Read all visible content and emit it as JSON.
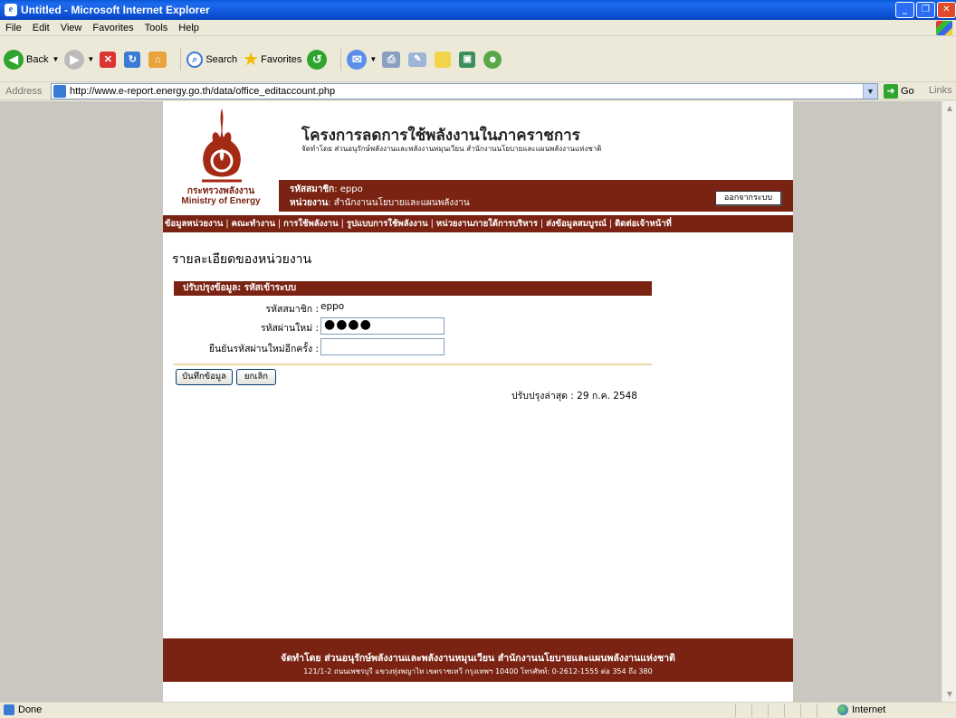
{
  "window": {
    "title": "Untitled - Microsoft Internet Explorer"
  },
  "menu": [
    "File",
    "Edit",
    "View",
    "Favorites",
    "Tools",
    "Help"
  ],
  "toolbar": {
    "back": "Back",
    "search": "Search",
    "favorites": "Favorites"
  },
  "address": {
    "label": "Address",
    "url": "http://www.e-report.energy.go.th/data/office_editaccount.php",
    "go": "Go",
    "links": "Links"
  },
  "header": {
    "ministry_th": "กระทรวงพลังงาน",
    "ministry_en": "Ministry of Energy",
    "project_title": "โครงการลดการใช้พลังงานในภาคราชการ",
    "project_subtitle": "จัดทำโดย ส่วนอนุรักษ์พลังงานและพลังงานหมุนเวียน สำนักงานนโยบายและแผนพลังงานแห่งชาติ"
  },
  "userbar": {
    "code_label": "รหัสสมาชิก",
    "code_value": ": eppo",
    "unit_label": "หน่วยงาน",
    "unit_value": ": สำนักงานนโยบายและแผนพลังงาน",
    "logout": "ออกจากระบบ"
  },
  "nav": [
    "ข้อมูลหน่วยงาน",
    "คณะทำงาน",
    "การใช้พลังงาน",
    "รูปแบบการใช้พลังงาน",
    "หน่วยงานภายใต้การบริหาร",
    "ส่งข้อมูลสมบูรณ์",
    "ติดต่อเจ้าหน้าที่"
  ],
  "page_title": "รายละเอียดของหน่วยงาน",
  "form": {
    "header": "ปรับปรุงข้อมูล: รหัสเข้าระบบ",
    "member_label": "รหัสสมาชิก :",
    "member_value": "eppo",
    "new_password_label": "รหัสผ่านใหม่ :",
    "new_password_value": "●●●●",
    "confirm_password_label": "ยืนยันรหัสผ่านใหม่อีกครั้ง :",
    "confirm_password_value": "",
    "save_button": "บันทึกข้อมูล",
    "cancel_button": "ยกเลิก",
    "last_updated": "ปรับปรุงล่าสุด : 29 ก.ค. 2548"
  },
  "footer": {
    "line1": "จัดทำโดย ส่วนอนุรักษ์พลังงานและพลังงานหมุนเวียน สำนักงานนโยบายและแผนพลังงานแห่งชาติ",
    "line2": "121/1-2 ถนนเพชรบุรี แขวงทุ่งพญาไท เขตราชเทวี กรุงเทพฯ 10400  โทรศัพท์: 0-2612-1555 ต่อ 354 ถึง 380"
  },
  "status": {
    "left": "Done",
    "zone": "Internet"
  },
  "colors": {
    "brand": "#7a2313",
    "accent_line": "#eed9a7"
  }
}
